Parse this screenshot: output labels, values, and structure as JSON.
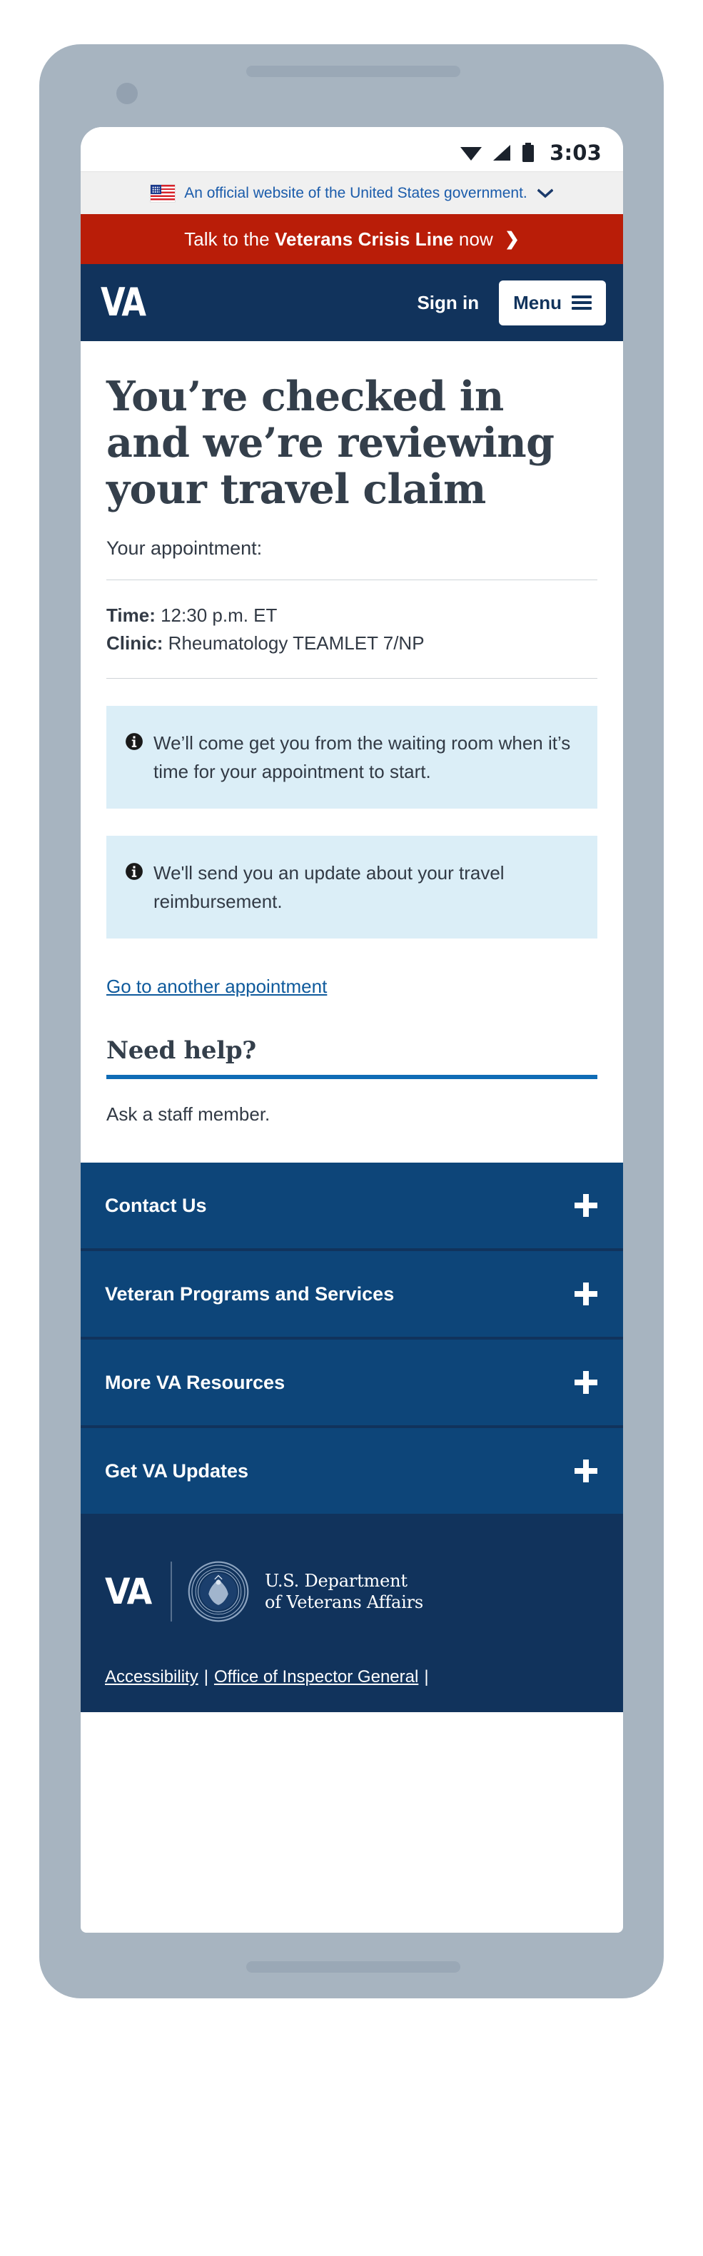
{
  "status_bar": {
    "time": "3:03",
    "icons": [
      "wifi-icon",
      "cellular-signal-icon",
      "battery-icon"
    ]
  },
  "gov_banner": {
    "text": "An official website of the United States government.",
    "flag_icon": "us-flag-icon",
    "expand_icon": "chevron-down-icon"
  },
  "crisis_banner": {
    "prefix": "Talk to the ",
    "bold": "Veterans Crisis Line",
    "suffix": " now",
    "arrow": "❯",
    "background": "#b91d08"
  },
  "header": {
    "logo": "VA",
    "sign_in_label": "Sign in",
    "menu_label": "Menu",
    "menu_icon": "hamburger-icon",
    "background": "#11335c"
  },
  "main": {
    "title": "You’re checked in and we’re reviewing your travel claim",
    "appointment_label": "Your appointment:",
    "details": [
      {
        "label": "Time:",
        "value": " 12:30 p.m. ET"
      },
      {
        "label": "Clinic:",
        "value": " Rheumatology TEAMLET 7/NP"
      }
    ],
    "alerts": [
      {
        "icon": "info-circle-icon",
        "text": "We’ll come get you from the waiting room when it’s time for your appointment to start."
      },
      {
        "icon": "info-circle-icon",
        "text": "We'll send you an update about your travel reimbursement."
      }
    ],
    "another_appointment_link": "Go to another appointment",
    "need_help_heading": "Need help?",
    "need_help_body": "Ask a staff member.",
    "accent_rule_color": "#0f6cb6",
    "alert_background": "#dbeef7"
  },
  "footer": {
    "accordion": [
      {
        "label": "Contact Us",
        "icon": "plus-icon"
      },
      {
        "label": "Veteran Programs and Services",
        "icon": "plus-icon"
      },
      {
        "label": "More VA Resources",
        "icon": "plus-icon"
      },
      {
        "label": "Get VA Updates",
        "icon": "plus-icon"
      }
    ],
    "logo": "VA",
    "seal_icon": "va-seal-icon",
    "department_line1": "U.S. Department",
    "department_line2": "of Veterans Affairs",
    "links": [
      "Accessibility",
      "Office of Inspector General"
    ],
    "separator": "|",
    "accordion_background": "#0d4579",
    "background": "#11335c"
  }
}
